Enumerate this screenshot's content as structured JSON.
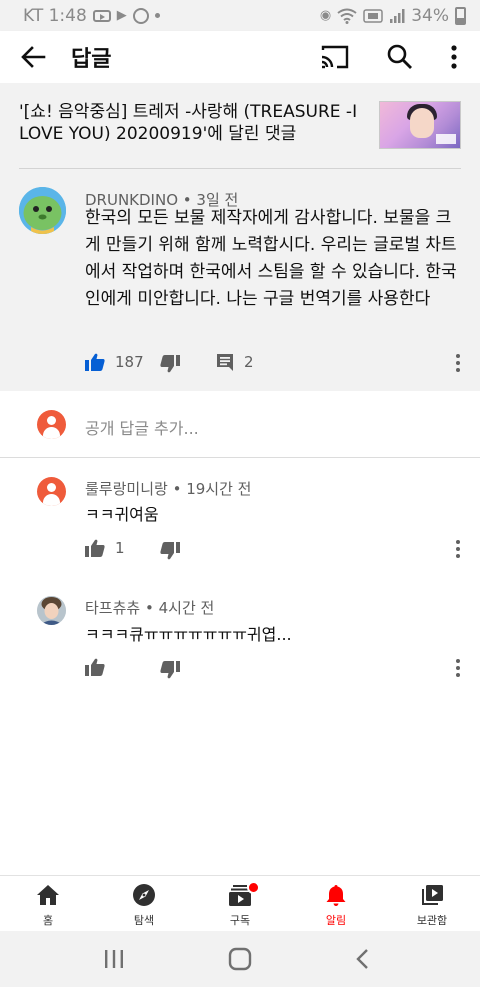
{
  "status_bar": {
    "carrier_time": "KT 1:48",
    "battery_percent": "34%"
  },
  "app_bar": {
    "title": "답글"
  },
  "video": {
    "title": "'[쇼! 음악중심] 트레저 -사랑해 (TREASURE -I LOVE YOU) 20200919'에 달린 댓글"
  },
  "main_comment": {
    "author": "DRUNKDINO",
    "time": "3일 전",
    "text": "한국의 모든 보물 제작자에게 감사합니다. 보물을 크게 만들기 위해 함께 노력합시다. 우리는 글로벌 차트에서 작업하며 한국에서 스팀을 할 수 있습니다. 한국인에게 미안합니다. 나는 구글 번역기를 사용한다",
    "likes": "187",
    "reply_count": "2"
  },
  "add_reply": {
    "placeholder": "공개 답글 추가..."
  },
  "replies": [
    {
      "author": "룰루랑미니랑",
      "time": "19시간 전",
      "text": "ㅋㅋ귀여움",
      "likes": "1"
    },
    {
      "author": "타프츄츄",
      "time": "4시간 전",
      "text": "ㅋㅋㅋ큐ㅠㅠㅠㅠㅠㅠㅠ귀엽...",
      "likes": ""
    }
  ],
  "bottom_nav": {
    "items": [
      {
        "label": "홈",
        "icon": "home-icon"
      },
      {
        "label": "탐색",
        "icon": "explore-icon"
      },
      {
        "label": "구독",
        "icon": "subscriptions-icon"
      },
      {
        "label": "알림",
        "icon": "notifications-icon"
      },
      {
        "label": "보관함",
        "icon": "library-icon"
      }
    ],
    "active": "알림"
  },
  "colors": {
    "accent_red": "#ff0000",
    "like_blue": "#065fd4",
    "avatar_orange": "#ef5b3b",
    "panel_gray": "#f2f2f2"
  }
}
